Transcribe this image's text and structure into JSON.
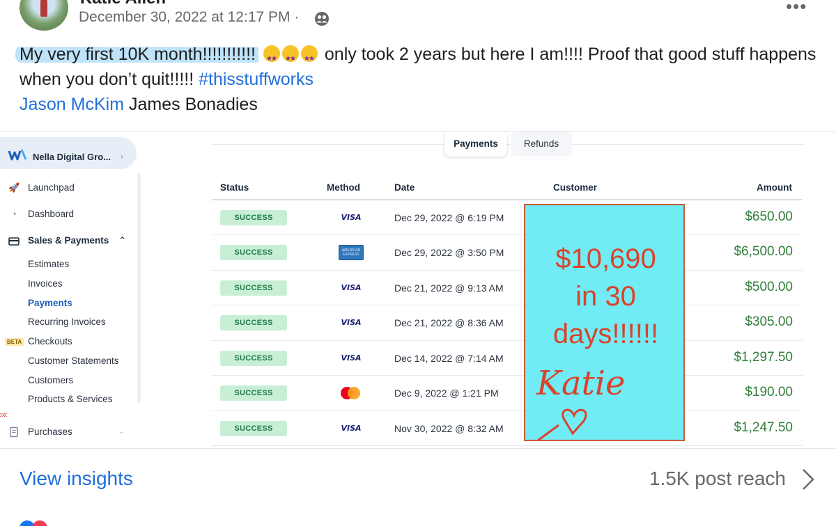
{
  "post": {
    "author": "Katie Allen",
    "date": "December 30, 2022 at 12:17 PM ·",
    "highlight_text": "My very first 10K month!!!!!!!!!!!",
    "text_after_emoji": " only took 2 years but here I am!!!! Proof that good stuff happens when you don’t quit!!!!! ",
    "hashtag": "#thisstuffworks",
    "tag_1": "Jason McKim",
    "tag_2": " James Bonadies"
  },
  "sidebar": {
    "business_name": "Nella Digital Gro...",
    "chevron": "›",
    "items": [
      {
        "label": "Launchpad",
        "icon": "rocket-icon"
      },
      {
        "label": "Dashboard",
        "icon": "gauge-icon"
      },
      {
        "label": "Sales & Payments",
        "icon": "card-icon"
      },
      {
        "label": "Estimates"
      },
      {
        "label": "Invoices"
      },
      {
        "label": "Payments"
      },
      {
        "label": "Recurring Invoices"
      },
      {
        "label": "Checkouts"
      },
      {
        "label": "Customer Statements"
      },
      {
        "label": "Customers"
      },
      {
        "label": "Products & Services"
      },
      {
        "label": "Purchases",
        "icon": "receipt-icon"
      }
    ],
    "beta_badge": "BETA",
    "ext_text": "ext"
  },
  "tabs": {
    "payments": "Payments",
    "refunds": "Refunds"
  },
  "table": {
    "headers": {
      "status": "Status",
      "method": "Method",
      "date": "Date",
      "customer": "Customer",
      "amount": "Amount"
    },
    "rows": [
      {
        "status": "SUCCESS",
        "method": "visa",
        "date": "Dec 29, 2022 @ 6:19 PM",
        "amount": "$650.00"
      },
      {
        "status": "SUCCESS",
        "method": "amex",
        "date": "Dec 29, 2022 @ 3:50 PM",
        "amount": "$6,500.00"
      },
      {
        "status": "SUCCESS",
        "method": "visa",
        "date": "Dec 21, 2022 @ 9:13 AM",
        "amount": "$500.00"
      },
      {
        "status": "SUCCESS",
        "method": "visa",
        "date": "Dec 21, 2022 @ 8:36 AM",
        "amount": "$305.00"
      },
      {
        "status": "SUCCESS",
        "method": "visa",
        "date": "Dec 14, 2022 @ 7:14 AM",
        "amount": "$1,297.50"
      },
      {
        "status": "SUCCESS",
        "method": "mastercard",
        "date": "Dec 9, 2022 @ 1:21 PM",
        "amount": "$190.00"
      },
      {
        "status": "SUCCESS",
        "method": "visa",
        "date": "Nov 30, 2022 @ 8:32 AM",
        "amount": "$1,247.50"
      }
    ],
    "visa_label": "VISA",
    "amex_label": "AMERICAN EXPRESS"
  },
  "note": {
    "line1": "$10,690",
    "line2": "in 30",
    "line3": "days!!!!!!",
    "signature": "Katie"
  },
  "footer": {
    "insights": "View insights",
    "reach": "1.5K post reach"
  },
  "colors": {
    "link": "#216fdb",
    "success_bg": "#c8efd6",
    "amount_green": "#2f7d3a",
    "note_bg": "#71ecf4",
    "note_ink": "#d9432b"
  }
}
